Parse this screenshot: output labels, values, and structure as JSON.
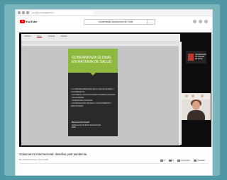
{
  "browser": {
    "url": "youtube.com/watch?v=..."
  },
  "youtube": {
    "logo_text": "YouTube",
    "search_value": "Universidad Autónoma de Chile"
  },
  "slide_app": {
    "tabs": [
      "Archivo",
      "Inicio",
      "Insertar",
      "Diseño"
    ]
  },
  "slide": {
    "title": "GOBERNANZA GLOBAL EN MATERIA DE SALUD",
    "bullets": [
      "• LA TRANSFORMACIÓN DE LA SALUD GLOBAL Y SUS DESAFÍOS",
      "• ACTORES E INSTITUCIONES INTERNACIONALES",
      "• LEGITIMIDAD",
      "• SOBERANÍA NACIONAL",
      "• COOPERACIÓN TÉCNICA, CONOCIMIENTO Y EFECTIVIDAD"
    ],
    "footer_heading": "Recursos Personal?",
    "footer_lines": [
      "Gobernanza de Salud Internacional",
      "2022"
    ]
  },
  "institution_logo": {
    "text": "UNIVERSIDAD AUTÓNOMA DE CHILE"
  },
  "video": {
    "title": "Gobernanza Internacional: desafíos post pandemia",
    "meta": "84 visualizaciones • 9 jun 2022",
    "actions": [
      "8",
      "0",
      "Compartir",
      "Guardar"
    ]
  }
}
